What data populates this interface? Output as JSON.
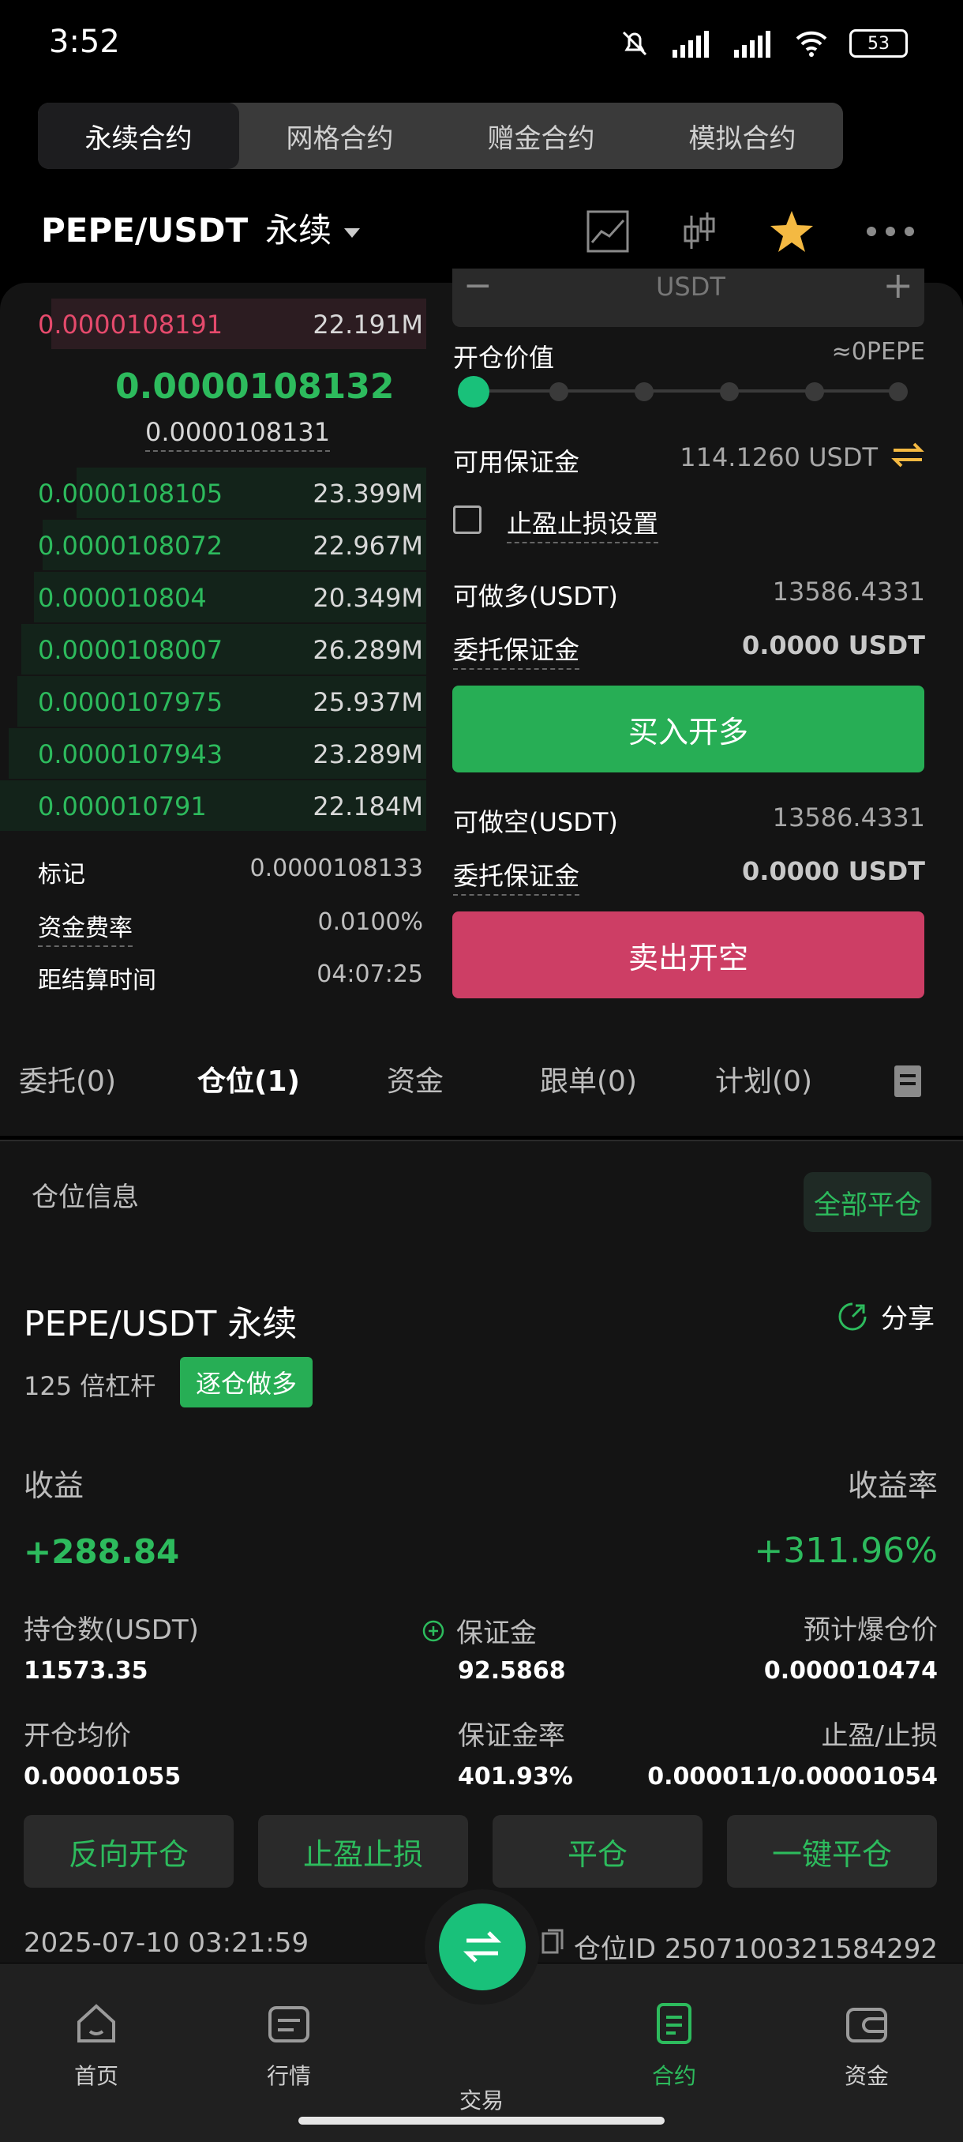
{
  "status": {
    "time": "3:52",
    "battery": "53"
  },
  "top_tabs": [
    {
      "label": "永续合约",
      "active": true
    },
    {
      "label": "网格合约",
      "active": false
    },
    {
      "label": "赠金合约",
      "active": false
    },
    {
      "label": "模拟合约",
      "active": false
    }
  ],
  "header": {
    "pair": "PEPE/USDT",
    "type": "永续"
  },
  "order_book": {
    "ask": {
      "price": "0.0000108191",
      "qty": "22.191M"
    },
    "last_price": "0.0000108132",
    "mark_price_sub": "0.0000108131",
    "bids": [
      {
        "price": "0.0000108105",
        "qty": "23.399M"
      },
      {
        "price": "0.0000108072",
        "qty": "22.967M"
      },
      {
        "price": "0.000010804",
        "qty": "20.349M"
      },
      {
        "price": "0.0000108007",
        "qty": "26.289M"
      },
      {
        "price": "0.0000107975",
        "qty": "25.937M"
      },
      {
        "price": "0.0000107943",
        "qty": "23.289M"
      },
      {
        "price": "0.000010791",
        "qty": "22.184M"
      }
    ],
    "mark_label": "标记",
    "mark_value": "0.0000108133",
    "funding_label": "资金费率",
    "funding_value": "0.0100%",
    "settle_label": "距结算时间",
    "settle_value": "04:07:25"
  },
  "order_form": {
    "unit": "USDT",
    "open_value_label": "开仓价值",
    "open_value": "≈0PEPE",
    "available_label": "可用保证金",
    "available_value": "114.1260 USDT",
    "tpsl_label": "止盈止损设置",
    "long_max_label": "可做多(USDT)",
    "long_max_value": "13586.4331",
    "long_margin_label": "委托保证金",
    "long_margin_value": "0.0000 USDT",
    "buy_label": "买入开多",
    "short_max_label": "可做空(USDT)",
    "short_max_value": "13586.4331",
    "short_margin_label": "委托保证金",
    "short_margin_value": "0.0000 USDT",
    "sell_label": "卖出开空"
  },
  "tabs": [
    {
      "label": "委托(0)"
    },
    {
      "label": "仓位(1)"
    },
    {
      "label": "资金"
    },
    {
      "label": "跟单(0)"
    },
    {
      "label": "计划(0)"
    }
  ],
  "position": {
    "section_title": "仓位信息",
    "close_all": "全部平仓",
    "pair_title": "PEPE/USDT 永续",
    "share": "分享",
    "leverage": "125 倍杠杆",
    "mode_badge": "逐仓做多",
    "pnl_label": "收益",
    "pnl_value": "+288.84",
    "roe_label": "收益率",
    "roe_value": "+311.96%",
    "size_label": "持仓数(USDT)",
    "size_value": "11573.35",
    "margin_label": "保证金",
    "margin_value": "92.5868",
    "liq_label": "预计爆仓价",
    "liq_value": "0.000010474",
    "entry_label": "开仓均价",
    "entry_value": "0.00001055",
    "margin_ratio_label": "保证金率",
    "margin_ratio_value": "401.93%",
    "tpsl_label": "止盈/止损",
    "tpsl_value": "0.000011/0.00001054",
    "actions": [
      "反向开仓",
      "止盈止损",
      "平仓",
      "一键平仓"
    ],
    "time": "2025-07-10 03:21:59",
    "position_id": "仓位ID 2507100321584292"
  },
  "nav": [
    {
      "label": "首页"
    },
    {
      "label": "行情"
    },
    {
      "label": "交易"
    },
    {
      "label": "合约",
      "active": true
    },
    {
      "label": "资金"
    }
  ],
  "colors": {
    "green": "#2dbb5d",
    "red": "#cd3e65",
    "teal": "#19c17a"
  }
}
